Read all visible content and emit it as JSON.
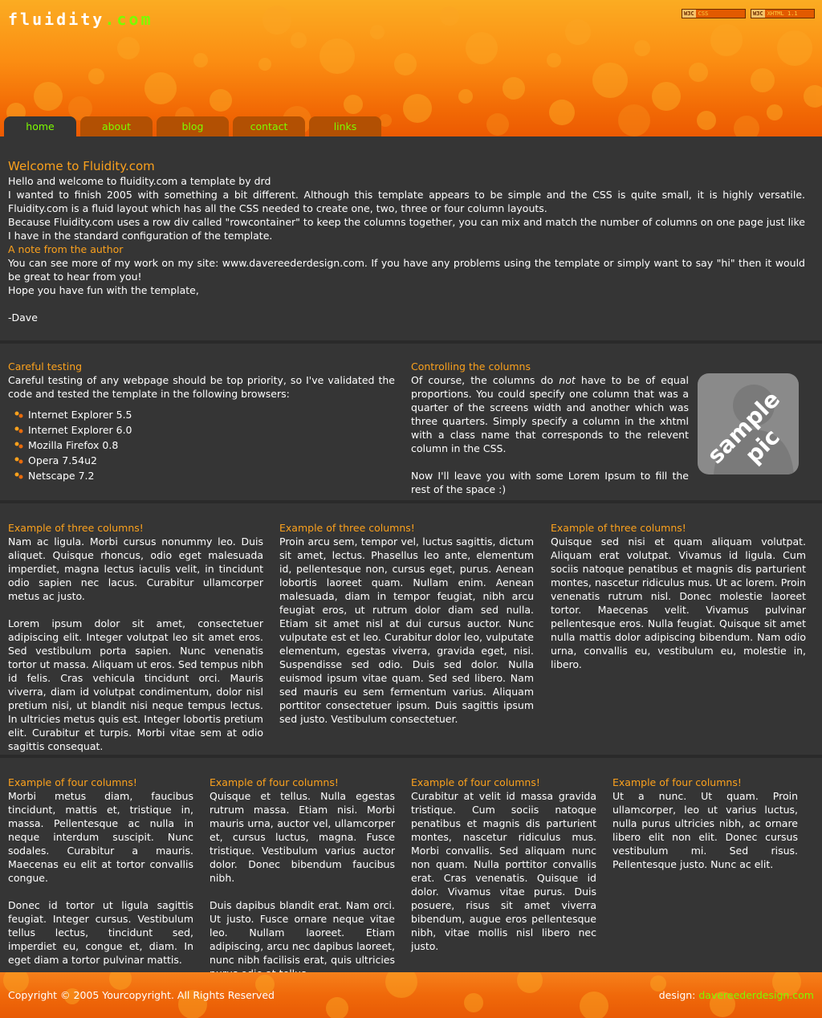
{
  "site": {
    "logo_main": "fluidity",
    "logo_dot": ".com",
    "badges": [
      {
        "w3": "W3C",
        "text": "CSS"
      },
      {
        "w3": "W3C",
        "text": "XHTML 1.1"
      }
    ]
  },
  "nav": {
    "tabs": [
      {
        "label": "home",
        "active": true
      },
      {
        "label": "about"
      },
      {
        "label": "blog"
      },
      {
        "label": "contact"
      },
      {
        "label": "links"
      }
    ]
  },
  "intro": {
    "title": "Welcome to Fluidity.com",
    "p1": "Hello and welcome to fluidity.com a template by drd",
    "p2": "I wanted to finish 2005 with something a bit different. Although this template appears to be simple and the CSS is quite small, it is highly versatile. Fluidity.com is a fluid layout which has all the CSS needed to create one, two, three or four column layouts.",
    "p3": "Because Fluidity.com uses a row div called \"rowcontainer\" to keep the columns together, you can mix and match the number of columns on one page just like I have in the standard configuration of the template.",
    "note_title": "A note from the author",
    "p4": "You can see more of my work on my site: www.davereederdesign.com. If you have any problems using the template or simply want to say \"hi\" then it would be great to hear from you!",
    "p5": "Hope you have fun with the template,",
    "signature": "-Dave"
  },
  "two_col": {
    "left": {
      "title": "Careful testing",
      "text": "Careful testing of any webpage should be top priority, so I've validated the code and tested the template in the following browsers:",
      "browsers": [
        "Internet Explorer 5.5",
        "Internet Explorer 6.0",
        "Mozilla Firefox 0.8",
        "Opera 7.54u2",
        "Netscape 7.2"
      ]
    },
    "right": {
      "title": "Controlling the columns",
      "text_a": "Of course, the columns do ",
      "text_em": "not",
      "text_b": " have to be of equal proportions. You could specify one column that was a quarter of the screens width and another which was three quarters. Simply specify a column in the xhtml with a class name that corresponds to the relevent column in the CSS.",
      "text2": "Now I'll leave you with some Lorem Ipsum to fill the rest of the space :)",
      "pic_label": "sample pic"
    }
  },
  "three_col": [
    {
      "title": "Example of three columns!",
      "p1": "Nam ac ligula. Morbi cursus nonummy leo. Duis aliquet. Quisque rhoncus, odio eget malesuada imperdiet, magna lectus iaculis velit, in tincidunt odio sapien nec lacus. Curabitur ullamcorper metus ac justo.",
      "p2": "Lorem ipsum dolor sit amet, consectetuer adipiscing elit. Integer volutpat leo sit amet eros. Sed vestibulum porta sapien. Nunc venenatis tortor ut massa. Aliquam ut eros. Sed tempus nibh id felis. Cras vehicula tincidunt orci. Mauris viverra, diam id volutpat condimentum, dolor nisl pretium nisi, ut blandit nisi neque tempus lectus. In ultricies metus quis est. Integer lobortis pretium elit. Curabitur et turpis. Morbi vitae sem at odio sagittis consequat."
    },
    {
      "title": "Example of three columns!",
      "p1": "Proin arcu sem, tempor vel, luctus sagittis, dictum sit amet, lectus. Phasellus leo ante, elementum id, pellentesque non, cursus eget, purus. Aenean lobortis laoreet quam. Nullam enim. Aenean malesuada, diam in tempor feugiat, nibh arcu feugiat eros, ut rutrum dolor diam sed nulla. Etiam sit amet nisl at dui cursus auctor. Nunc vulputate est et leo. Curabitur dolor leo, vulputate elementum, egestas viverra, gravida eget, nisi. Suspendisse sed odio. Duis sed dolor. Nulla euismod ipsum vitae quam. Sed sed libero. Nam sed mauris eu sem fermentum varius. Aliquam porttitor consectetuer ipsum. Duis sagittis ipsum sed justo. Vestibulum consectetuer.",
      "p2": ""
    },
    {
      "title": "Example of three columns!",
      "p1": "Quisque sed nisi et quam aliquam volutpat. Aliquam erat volutpat. Vivamus id ligula. Cum sociis natoque penatibus et magnis dis parturient montes, nascetur ridiculus mus. Ut ac lorem. Proin venenatis rutrum nisl. Donec molestie laoreet tortor. Maecenas velit. Vivamus pulvinar pellentesque eros. Nulla feugiat. Quisque sit amet nulla mattis dolor adipiscing bibendum. Nam odio urna, convallis eu, vestibulum eu, molestie in, libero.",
      "p2": ""
    }
  ],
  "four_col": [
    {
      "title": "Example of four columns!",
      "p1": "Morbi metus diam, faucibus tincidunt, mattis et, tristique in, massa. Pellentesque ac nulla in neque interdum suscipit. Nunc sodales. Curabitur a mauris. Maecenas eu elit at tortor convallis congue.",
      "p2": "Donec id tortor ut ligula sagittis feugiat. Integer cursus. Vestibulum tellus lectus, tincidunt sed, imperdiet eu, congue et, diam. In eget diam a tortor pulvinar mattis."
    },
    {
      "title": "Example of four columns!",
      "p1": "Quisque et tellus. Nulla egestas rutrum massa. Etiam nisi. Morbi mauris urna, auctor vel, ullamcorper et, cursus luctus, magna. Fusce tristique. Vestibulum varius auctor dolor. Donec bibendum faucibus nibh.",
      "p2": "Duis dapibus blandit erat. Nam orci. Ut justo. Fusce ornare neque vitae leo. Nullam laoreet. Etiam adipiscing, arcu nec dapibus laoreet, nunc nibh facilisis erat, quis ultricies purus odio at tellus."
    },
    {
      "title": "Example of four columns!",
      "p1": "Curabitur at velit id massa gravida tristique. Cum sociis natoque penatibus et magnis dis parturient montes, nascetur ridiculus mus. Morbi convallis. Sed aliquam nunc non quam. Nulla porttitor convallis erat. Cras venenatis. Quisque id dolor. Vivamus vitae purus. Duis posuere, risus sit amet viverra bibendum, augue eros pellentesque nibh, vitae mollis nisl libero nec justo.",
      "p2": ""
    },
    {
      "title": "Example of four columns!",
      "p1": "Ut a nunc. Ut quam. Proin ullamcorper, leo ut varius luctus, nulla purus ultricies nibh, ac ornare libero elit non elit. Donec cursus vestibulum mi. Sed risus. Pellentesque justo. Nunc ac elit.",
      "p2": ""
    }
  ],
  "footer": {
    "copyright": "Copyright © 2005 Yourcopyright. All Rights Reserved",
    "design_label": "design:",
    "design_link": "davereederdesign.com"
  },
  "colors": {
    "background": "#353535",
    "heading": "#fba11d",
    "nav_link": "#7cfc00",
    "header_orange": "#f26a05"
  }
}
